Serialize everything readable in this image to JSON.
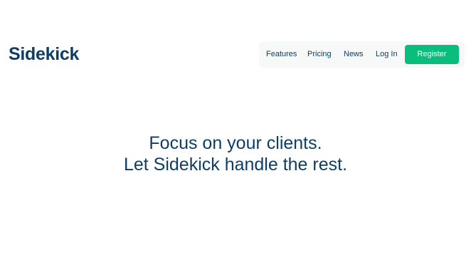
{
  "brand": {
    "name": "Sidekick"
  },
  "nav": {
    "links": [
      "Features",
      "Pricing",
      "News",
      "Log In"
    ],
    "register_label": "Register"
  },
  "hero": {
    "line1": "Focus on your clients.",
    "line2": "Let Sidekick handle the rest."
  },
  "colors": {
    "primary_text": "#0f3d64",
    "accent": "#0bbd7c",
    "nav_background": "#f7f8f8",
    "background": "#ffffff"
  }
}
